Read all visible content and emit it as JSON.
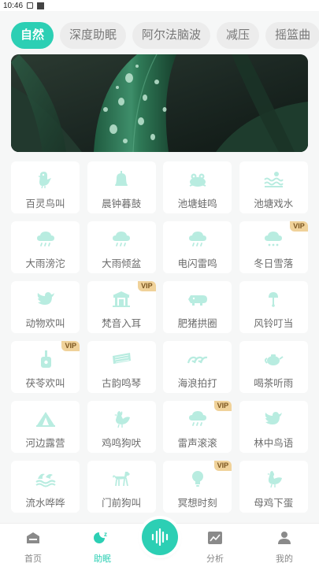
{
  "status": {
    "time": "10:46"
  },
  "tabs": [
    {
      "label": "自然",
      "active": true
    },
    {
      "label": "深度助眠"
    },
    {
      "label": "阿尔法脑波"
    },
    {
      "label": "减压"
    },
    {
      "label": "摇篮曲"
    }
  ],
  "colors": {
    "accent": "#2ccfb4",
    "vip_bg": "#f0d29a"
  },
  "grid": {
    "vip_label": "VIP",
    "items": [
      {
        "label": "百灵鸟叫",
        "icon": "bird-icon",
        "vip": false
      },
      {
        "label": "晨钟暮鼓",
        "icon": "bell-icon",
        "vip": false
      },
      {
        "label": "池塘蛙鸣",
        "icon": "frog-icon",
        "vip": false
      },
      {
        "label": "池塘戏水",
        "icon": "pond-water-icon",
        "vip": false
      },
      {
        "label": "大雨滂沱",
        "icon": "rain-cloud-icon",
        "vip": false
      },
      {
        "label": "大雨倾盆",
        "icon": "rain-cloud-icon",
        "vip": false
      },
      {
        "label": "电闪雷鸣",
        "icon": "rain-cloud-icon",
        "vip": false
      },
      {
        "label": "冬日雪落",
        "icon": "snow-cloud-icon",
        "vip": true
      },
      {
        "label": "动物欢叫",
        "icon": "bird-icon",
        "vip": false
      },
      {
        "label": "梵音入耳",
        "icon": "temple-icon",
        "vip": true
      },
      {
        "label": "肥猪拱圈",
        "icon": "pig-icon",
        "vip": false
      },
      {
        "label": "风铃叮当",
        "icon": "wind-chime-icon",
        "vip": false
      },
      {
        "label": "茯苓欢叫",
        "icon": "guitar-icon",
        "vip": true
      },
      {
        "label": "古韵鸣琴",
        "icon": "zither-icon",
        "vip": false
      },
      {
        "label": "海浪拍打",
        "icon": "wave-icon",
        "vip": false
      },
      {
        "label": "喝茶听雨",
        "icon": "teapot-icon",
        "vip": false
      },
      {
        "label": "河边露营",
        "icon": "tent-icon",
        "vip": false
      },
      {
        "label": "鸡鸣狗吠",
        "icon": "rooster-icon",
        "vip": false
      },
      {
        "label": "雷声滚滚",
        "icon": "rain-cloud-icon",
        "vip": true
      },
      {
        "label": "林中鸟语",
        "icon": "bird-icon",
        "vip": false
      },
      {
        "label": "流水哗哗",
        "icon": "water-flow-icon",
        "vip": false
      },
      {
        "label": "门前狗叫",
        "icon": "dog-icon",
        "vip": false
      },
      {
        "label": "冥想时刻",
        "icon": "lightbulb-icon",
        "vip": true
      },
      {
        "label": "母鸡下蛋",
        "icon": "hen-icon",
        "vip": false
      }
    ]
  },
  "navbar": {
    "items": [
      {
        "label": "首页",
        "icon": "home-icon"
      },
      {
        "label": "助眠",
        "icon": "moon-icon",
        "active": true
      },
      {
        "label": "",
        "icon": "soundwave-icon"
      },
      {
        "label": "分析",
        "icon": "chart-icon"
      },
      {
        "label": "我的",
        "icon": "user-icon"
      }
    ]
  }
}
